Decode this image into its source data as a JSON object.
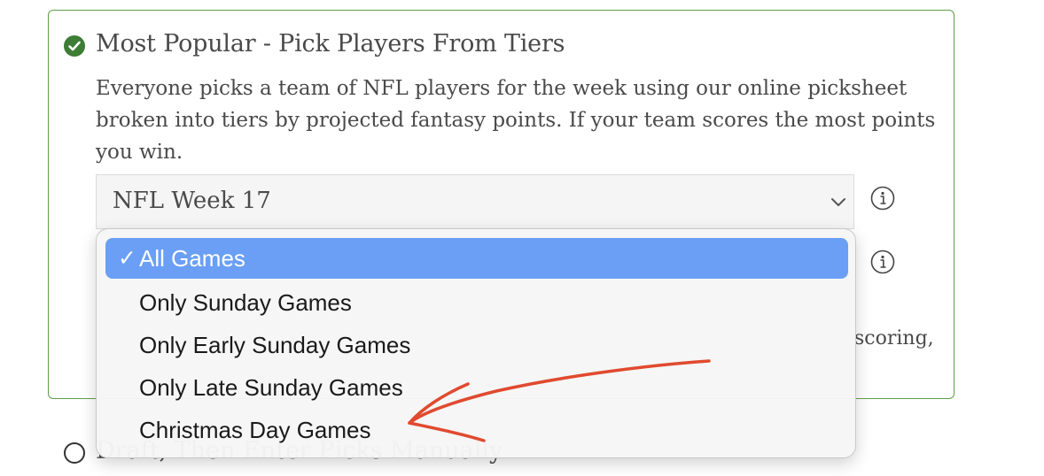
{
  "selected_option": {
    "title": "Most Popular - Pick Players From Tiers",
    "description": "Everyone picks a team of NFL players for the week using our online picksheet broken into tiers by projected fantasy points. If your team scores the most points you win.",
    "week_select": {
      "value": "NFL Week 17"
    },
    "partial_text": "scoring,"
  },
  "games_dropdown": {
    "options": [
      {
        "label": "All Games",
        "selected": true
      },
      {
        "label": "Only Sunday Games",
        "selected": false
      },
      {
        "label": "Only Early Sunday Games",
        "selected": false
      },
      {
        "label": "Only Late Sunday Games",
        "selected": false
      },
      {
        "label": "Christmas Day Games",
        "selected": false
      }
    ],
    "check_glyph": "✓"
  },
  "second_option": {
    "title": "Draft, Then Enter Picks Manually"
  },
  "colors": {
    "card_border": "#5f9e4a",
    "check_green": "#3d7d35",
    "selected_item": "#6a9ff5",
    "annotation_arrow": "#e04a2f"
  },
  "icons": {
    "status": "check-circle-icon",
    "info": "info-icon",
    "chevron": "chevron-down-icon"
  }
}
